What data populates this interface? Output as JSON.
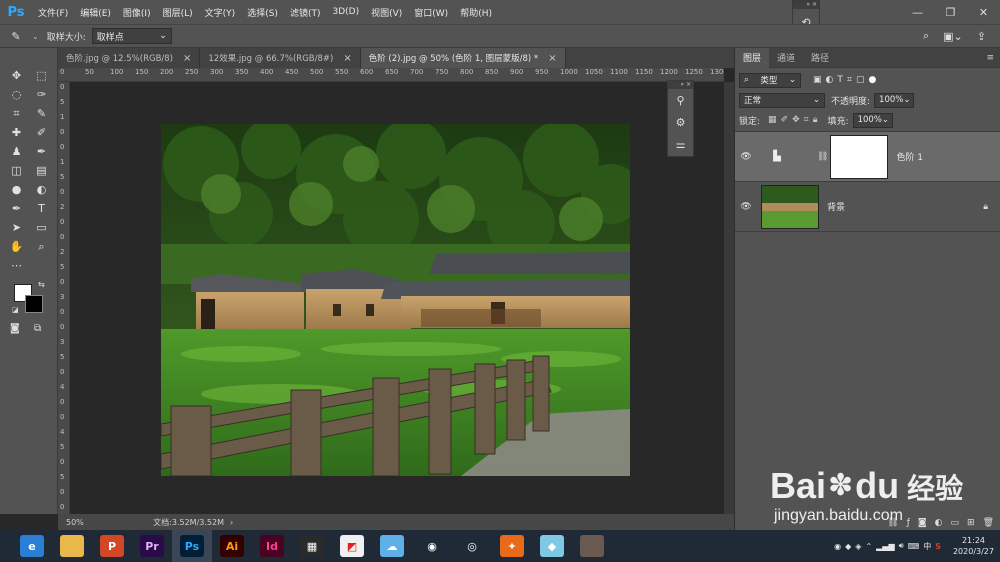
{
  "app": {
    "logo": "Ps"
  },
  "menu": [
    "文件(F)",
    "编辑(E)",
    "图像(I)",
    "图层(L)",
    "文字(Y)",
    "选择(S)",
    "滤镜(T)",
    "3D(D)",
    "视图(V)",
    "窗口(W)",
    "帮助(H)"
  ],
  "options": {
    "sample_size_label": "取样大小:",
    "sample_size_value": "取样点"
  },
  "tabs": [
    {
      "label": "色阶.jpg @ 12.5%(RGB/8)",
      "close": "×"
    },
    {
      "label": "12效果.jpg @ 66.7%(RGB/8#)",
      "close": "×"
    },
    {
      "label": "色阶 (2).jpg @ 50% (色阶 1, 图层蒙版/8) *",
      "close": "×"
    }
  ],
  "ruler": {
    "top": [
      "0",
      "50",
      "100",
      "150",
      "200",
      "250",
      "300",
      "350",
      "400",
      "450",
      "500",
      "550",
      "600",
      "650",
      "700",
      "750",
      "800",
      "850",
      "900",
      "950",
      "1000",
      "1050",
      "1100",
      "1150",
      "1200",
      "1250",
      "1300"
    ],
    "left": [
      "0",
      "5",
      "1",
      "0",
      "0",
      "1",
      "5",
      "0",
      "2",
      "0",
      "0",
      "2",
      "5",
      "0",
      "3",
      "0",
      "0",
      "3",
      "5",
      "0",
      "4",
      "0",
      "0",
      "4",
      "5",
      "0",
      "5",
      "0",
      "0"
    ]
  },
  "status": {
    "zoom": "50%",
    "doc": "文档:3.52M/3.52M",
    "arrow": "›"
  },
  "layers_panel": {
    "tabs": [
      "图层",
      "通道",
      "路径"
    ],
    "filter_kind": "类型",
    "blend_mode": "正常",
    "opacity_label": "不透明度:",
    "opacity_value": "100%",
    "lock_label": "锁定:",
    "fill_label": "填充:",
    "fill_value": "100%",
    "layers": [
      {
        "name": "色阶 1",
        "selected": true
      },
      {
        "name": "背景",
        "selected": false
      }
    ]
  },
  "taskbar": {
    "apps": [
      {
        "name": "browser",
        "label": "e",
        "color": "#2a7fd4"
      },
      {
        "name": "explorer",
        "label": "",
        "color": "#e8b84a"
      },
      {
        "name": "powerpoint",
        "label": "P",
        "color": "#d24726"
      },
      {
        "name": "premiere",
        "label": "Pr",
        "color": "#2a0b4a"
      },
      {
        "name": "photoshop",
        "label": "Ps",
        "color": "#001e36"
      },
      {
        "name": "illustrator",
        "label": "Ai",
        "color": "#330000"
      },
      {
        "name": "indesign",
        "label": "Id",
        "color": "#49021f"
      },
      {
        "name": "video",
        "label": "▦",
        "color": "#2a2a2a"
      },
      {
        "name": "app-green",
        "label": "◩",
        "color": "#f0f0f0"
      },
      {
        "name": "app-blue",
        "label": "☁",
        "color": "#5fb0e8"
      },
      {
        "name": "qq",
        "label": "◉",
        "color": "#1f2a36"
      },
      {
        "name": "chrome",
        "label": "◎",
        "color": "#1f2a36"
      },
      {
        "name": "app-orange",
        "label": "✦",
        "color": "#e86a1a"
      },
      {
        "name": "app-cyan",
        "label": "◆",
        "color": "#7ec8e3"
      },
      {
        "name": "app-photo",
        "label": "",
        "color": "#6b5a50"
      }
    ],
    "time": "21:24",
    "date": "2020/3/27",
    "ime": "中"
  },
  "watermark": {
    "brand": "Bai",
    "brand2": "du",
    "cn": "经验",
    "url": "jingyan.baidu.com"
  },
  "colors": {
    "ui_dark": "#535353",
    "ps_blue": "#31a8ff",
    "canvas_bg": "#282828"
  }
}
